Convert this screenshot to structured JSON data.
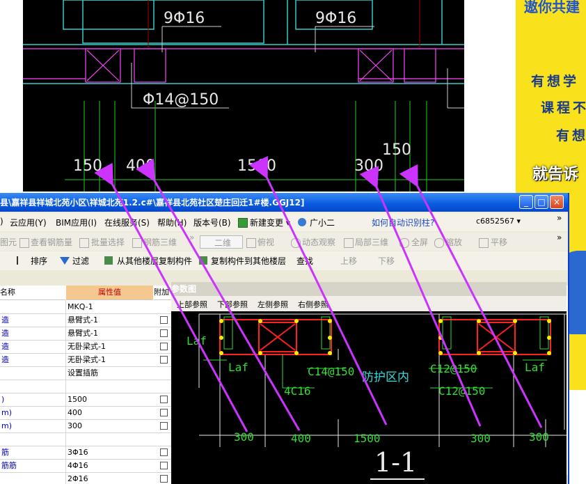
{
  "cad_top": {
    "labels": [
      "9Φ16",
      "9Φ16",
      "Φ14@150",
      "150",
      "400",
      "1500",
      "300",
      "150"
    ]
  },
  "ad": {
    "lines": [
      "遨你共建",
      "有想学",
      "课程不",
      "有想",
      "就告诉"
    ],
    "colors": {
      "bg": "#f9e21c",
      "text": "#1a3a8a",
      "headline": "#2255cc"
    }
  },
  "window": {
    "title": "县\\嘉祥县祥城北苑小区\\祥城北苑1.2.c#\\嘉祥县北苑社区楚庄回迁1#楼.GGJ12]",
    "controls": {
      "minimize": "_",
      "maximize": "□",
      "close": "×"
    }
  },
  "menubar": {
    "items": [
      ")",
      "云应用(Y)",
      "BIM应用(I)",
      "在线服务(S)",
      "帮助(H)",
      "版本号(B)",
      "新建变更 ▾",
      "广小二"
    ],
    "help_link": "如何自动识别柱?",
    "user": "c6852567 ▾",
    "more": "»"
  },
  "toolbar1": {
    "items": [
      "图元",
      "查看钢筋量",
      "批量选择",
      "钢筋三维",
      "二维",
      "俯视",
      "动态观察",
      "局部三维",
      "全屏",
      "缩放",
      "平移"
    ],
    "more": "»"
  },
  "toolbar2": {
    "items": [
      "排序",
      "过滤",
      "从其他楼层复制构件",
      "复制构件到其他楼层",
      "查找",
      "上移",
      "下移"
    ]
  },
  "property_grid": {
    "headers": {
      "name": "名称",
      "value": "属性值",
      "extra": "附加"
    },
    "rows": [
      {
        "name": "",
        "value": "MKQ-1",
        "check": false
      },
      {
        "name": "造",
        "value": "悬臂式-1",
        "check": true
      },
      {
        "name": "造",
        "value": "悬臂式-1",
        "check": true
      },
      {
        "name": "造",
        "value": "无卧梁式-1",
        "check": true
      },
      {
        "name": "造",
        "value": "无卧梁式-1",
        "check": true
      },
      {
        "name": "",
        "value": "设置插筋",
        "check": false
      },
      {
        "name": "",
        "value": "",
        "check": false
      },
      {
        "name": ")",
        "value": "1500",
        "check": true
      },
      {
        "name": "m)",
        "value": "400",
        "check": true
      },
      {
        "name": "m)",
        "value": "300",
        "check": true
      },
      {
        "name": "",
        "value": "",
        "check": false
      },
      {
        "name": "筋",
        "value": "3Φ16",
        "check": true
      },
      {
        "name": "筋筋",
        "value": "4Φ16",
        "check": true
      },
      {
        "name": "",
        "value": "2Φ16",
        "check": true
      }
    ],
    "colors": {
      "header_value_bg": "#f5c890",
      "header_value_text": "#c00000",
      "name_text": "#0000cc"
    }
  },
  "param_window": {
    "title": "参数图",
    "tabs": [
      "上部参照",
      "下部参照",
      "左侧参照",
      "右侧参照"
    ],
    "labels": {
      "laf_left": "Laf",
      "laf_mid_left": "Laf",
      "laf_right": "Laf",
      "c14": "C14@150",
      "zone": "防护区内",
      "c12_a": "C12@150",
      "c12_b": "C12@150",
      "c16": "4C16",
      "section": "1-1",
      "dim_300_left": "300",
      "dim_400": "400",
      "dim_1500": "1500",
      "dim_300_mid": "300",
      "dim_300_right": "300"
    },
    "colors": {
      "green": "#33dd33",
      "cyan": "#33dddd",
      "red": "#ff2020",
      "dot": "#ffee00"
    }
  },
  "colors": {
    "arrow": "#cc33ff",
    "cad_green": "#22cc22",
    "cad_magenta": "#ff44ff"
  }
}
